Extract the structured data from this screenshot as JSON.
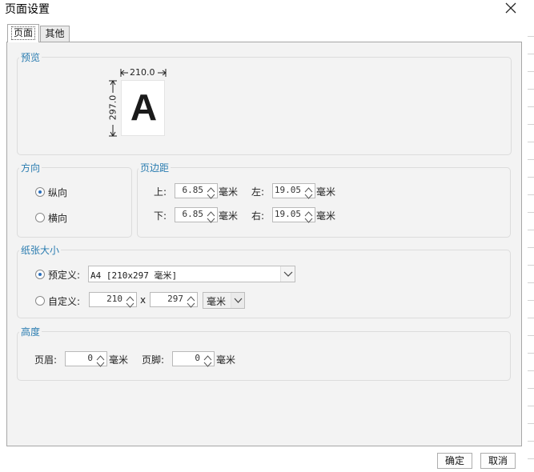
{
  "window": {
    "title": "页面设置",
    "close_icon": "close-icon"
  },
  "tabs": [
    {
      "label": "页面"
    },
    {
      "label": "其他"
    }
  ],
  "preview": {
    "title": "预览",
    "width_label": "210.0",
    "height_label": "297.0",
    "letter": "A"
  },
  "orientation": {
    "title": "方向",
    "options": [
      {
        "label": "纵向",
        "checked": true
      },
      {
        "label": "横向",
        "checked": false
      }
    ]
  },
  "margins": {
    "title": "页边距",
    "top": {
      "label": "上:",
      "value": "6.85",
      "unit": "毫米"
    },
    "left": {
      "label": "左:",
      "value": "19.05",
      "unit": "毫米"
    },
    "bottom": {
      "label": "下:",
      "value": "6.85",
      "unit": "毫米"
    },
    "right": {
      "label": "右:",
      "value": "19.05",
      "unit": "毫米"
    }
  },
  "paper": {
    "title": "纸张大小",
    "predefined": {
      "label": "预定义:",
      "checked": true,
      "value": "A4 [210x297 毫米]"
    },
    "custom": {
      "label": "自定义:",
      "checked": false,
      "width": "210",
      "times": "x",
      "height": "297",
      "unit": "毫米"
    }
  },
  "height": {
    "title": "高度",
    "header": {
      "label": "页眉:",
      "value": "0",
      "unit": "毫米"
    },
    "footer": {
      "label": "页脚:",
      "value": "0",
      "unit": "毫米"
    }
  },
  "buttons": {
    "ok": "确定",
    "cancel": "取消"
  }
}
